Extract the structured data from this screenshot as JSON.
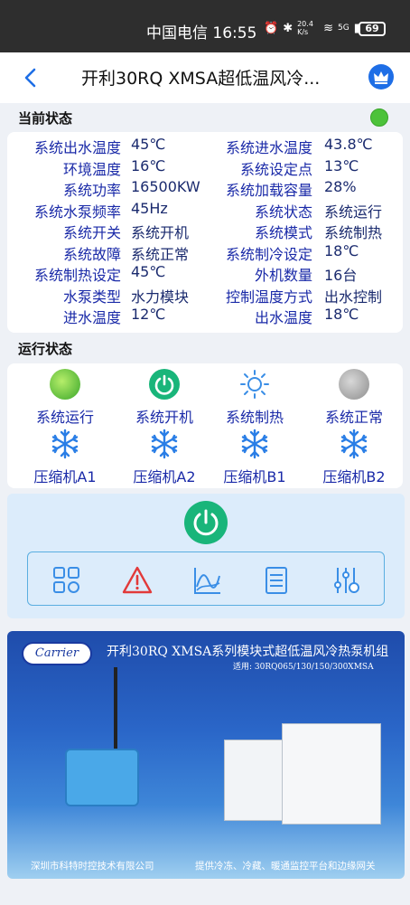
{
  "statusbar": {
    "carrier_time": "中国电信 16:55",
    "net_speed": "20.4 K/s",
    "signal": "5G",
    "battery": "69"
  },
  "header": {
    "title": "开利30RQ XMSA超低温风冷..."
  },
  "current_status": {
    "label": "当前状态",
    "rows": [
      {
        "l1": "系统出水温度",
        "v1": "45℃",
        "l2": "系统进水温度",
        "v2": "43.8℃"
      },
      {
        "l1": "环境温度",
        "v1": "16℃",
        "l2": "系统设定点",
        "v2": "13℃"
      },
      {
        "l1": "系统功率",
        "v1": "16500KW",
        "l2": "系统加载容量",
        "v2": "28%"
      },
      {
        "l1": "系统水泵频率",
        "v1": "45Hz",
        "l2": "系统状态",
        "v2": "系统运行"
      },
      {
        "l1": "系统开关",
        "v1": "系统开机",
        "l2": "系统模式",
        "v2": "系统制热"
      },
      {
        "l1": "系统故障",
        "v1": "系统正常",
        "l2": "系统制冷设定",
        "v2": "18℃"
      },
      {
        "l1": "系统制热设定",
        "v1": "45℃",
        "l2": "外机数量",
        "v2": "16台"
      },
      {
        "l1": "水泵类型",
        "v1": "水力模块",
        "l2": "控制温度方式",
        "v2": "出水控制"
      },
      {
        "l1": "进水温度",
        "v1": "12℃",
        "l2": "出水温度",
        "v2": "18℃"
      }
    ]
  },
  "run_status": {
    "label": "运行状态",
    "indicators": [
      {
        "label": "系统运行",
        "icon": "running-dot-icon"
      },
      {
        "label": "系统开机",
        "icon": "power-on-icon"
      },
      {
        "label": "系统制热",
        "icon": "sun-icon"
      },
      {
        "label": "系统正常",
        "icon": "normal-dot-icon"
      },
      {
        "label": "压缩机A1",
        "icon": "snowflake-icon"
      },
      {
        "label": "压缩机A2",
        "icon": "snowflake-icon"
      },
      {
        "label": "压缩机B1",
        "icon": "snowflake-icon"
      },
      {
        "label": "压缩机B2",
        "icon": "snowflake-icon"
      }
    ]
  },
  "banner": {
    "logo": "Carrier",
    "title": "开利30RQ XMSA系列模块式超低温风冷热泵机组",
    "subtitle": "适用: 30RQ065/130/150/300XMSA",
    "footer_left": "深圳市科特时控技术有限公司",
    "footer_right": "提供冷冻、冷藏、暖通监控平台和边缘网关"
  },
  "colors": {
    "accent": "#1a2aa8",
    "status_green": "#4cc23a",
    "power_green": "#19b57a",
    "alarm_red": "#e23a3a",
    "icon_blue": "#3a8ee6"
  }
}
